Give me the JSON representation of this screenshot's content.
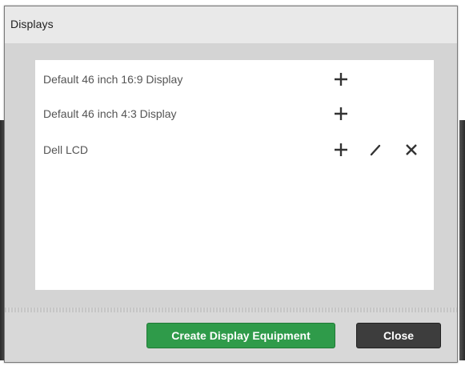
{
  "dialog": {
    "title": "Displays"
  },
  "displays": [
    {
      "label": "Default 46 inch 16:9 Display",
      "actions": [
        "add"
      ]
    },
    {
      "label": "Default 46 inch 4:3 Display",
      "actions": [
        "add"
      ]
    },
    {
      "label": "Dell LCD",
      "actions": [
        "add",
        "edit",
        "delete"
      ]
    }
  ],
  "icons": {
    "add": "plus-icon",
    "edit": "pencil-icon",
    "delete": "close-icon"
  },
  "footer": {
    "create_label": "Create Display Equipment",
    "close_label": "Close"
  },
  "colors": {
    "create_button": "#2f9b4a",
    "close_button": "#3d3d3d",
    "icon": "#333333"
  }
}
